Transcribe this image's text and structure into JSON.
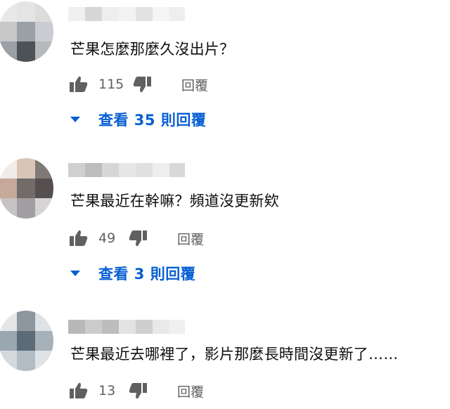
{
  "comments": [
    {
      "text": "芒果怎麼那麼久沒出片？",
      "likes": "115",
      "reply_label": "回覆",
      "view_replies": "查看 35 則回覆",
      "avatar_colors": [
        "#e8e8e8",
        "#e4e4e4",
        "#dcdcdc",
        "#c8c8c8",
        "#9aa0a6",
        "#c9ccd0",
        "#9aa0a5",
        "#4d5257",
        "#b7b9bb"
      ],
      "name_colors": [
        "#f0f0f0",
        "#d6d6d6",
        "#eeeeee",
        "#f3f3f3",
        "#e2e2e2",
        "#f5f5f5",
        "#eeeeee"
      ]
    },
    {
      "text": "芒果最近在幹嘛？頻道沒更新欸",
      "likes": "49",
      "reply_label": "回覆",
      "view_replies": "查看 3 則回覆",
      "avatar_colors": [
        "#f1ece8",
        "#d9c5b7",
        "#7f7a75",
        "#c6a99a",
        "#716b69",
        "#55504f",
        "#c8c3c3",
        "#a09ea1",
        "#d6d4d5"
      ],
      "name_colors": [
        "#cfcfcf",
        "#bdbdbd",
        "#d6d6d6",
        "#e6e6e6",
        "#e0e0e0",
        "#eeeeee",
        "#d8d8d8"
      ]
    },
    {
      "text": "芒果最近去哪裡了，影片那麼長時間沒更新了……",
      "likes": "13",
      "reply_label": "回覆",
      "avatar_colors": [
        "#e4e6e8",
        "#8c97a0",
        "#dfe2e4",
        "#9aa6b0",
        "#5c6b78",
        "#a7b1b9",
        "#d4d9dd",
        "#b2bcc4",
        "#dfe3e6"
      ],
      "name_colors": [
        "#b8b8b8",
        "#cccccc",
        "#bdbdbd",
        "#e3e3e3",
        "#cfcfcf",
        "#e9e9e9",
        "#f0f0f0"
      ]
    }
  ]
}
